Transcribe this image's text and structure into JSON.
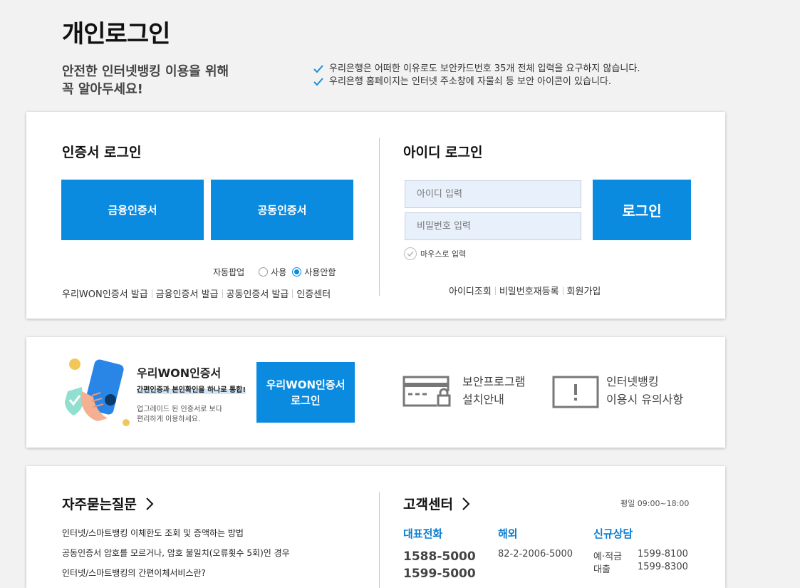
{
  "page": {
    "title": "개인로그인"
  },
  "notice": {
    "heading_line1": "안전한 인터넷뱅킹 이용을 위해",
    "heading_line2": "꼭 알아두세요!",
    "items": [
      "우리은행은 어떠한 이유로도 보안카드번호 35개 전체 입력을 요구하지 않습니다.",
      "우리은행 홈페이지는 인터넷 주소창에 자물쇠 등 보안 아이콘이 있습니다."
    ]
  },
  "cert_login": {
    "title": "인증서 로그인",
    "financial_cert_button": "금융인증서",
    "joint_cert_button": "공동인증서",
    "auto_popup_label": "자동팝업",
    "radio_use": "사용",
    "radio_no_use": "사용안함",
    "auto_popup_selected": "사용안함",
    "links": [
      "우리WON인증서 발급",
      "금융인증서 발급",
      "공동인증서 발급",
      "인증센터"
    ]
  },
  "id_login": {
    "title": "아이디 로그인",
    "id_placeholder": "아이디 입력",
    "password_placeholder": "비밀번호 입력",
    "login_button": "로그인",
    "mouse_input_label": "마우스로 입력",
    "links": [
      "아이디조회",
      "비밀번호재등록",
      "회원가입"
    ]
  },
  "won_cert": {
    "title": "우리WON인증서",
    "subtitle": "간편인증과 본인확인을 하나로 통합!",
    "desc_line1": "업그레이드 된 인증서로 보다",
    "desc_line2": "편리하게 이용하세요.",
    "login_button_line1": "우리WON인증서",
    "login_button_line2": "로그인",
    "security_program_line1": "보안프로그램",
    "security_program_line2": "설치안내",
    "caution_line1": "인터넷뱅킹",
    "caution_line2": "이용시 유의사항"
  },
  "faq": {
    "title": "자주묻는질문",
    "items": [
      "인터넷/스마트뱅킹 이체한도 조회 및 증액하는 방법",
      "공동인증서 암호를 모르거나, 암호 불일치(오류횟수 5회)인 경우",
      "인터넷/스마트뱅킹의 간편이체서비스란?"
    ]
  },
  "customer_center": {
    "title": "고객센터",
    "hours": "평일 09:00~18:00",
    "main_phone_label": "대표전화",
    "main_phone_1": "1588-5000",
    "main_phone_2": "1599-5000",
    "overseas_label": "해외",
    "overseas_phone": "82-2-2006-5000",
    "new_consult_label": "신규상담",
    "deposit_label": "예·적금",
    "deposit_phone": "1599-8100",
    "loan_label": "대출",
    "loan_phone": "1599-8300"
  },
  "colors": {
    "primary_blue": "#0a8be0",
    "input_bg": "#e8f0fb",
    "background": "#f2f2f2",
    "link_blue": "#0a7dd0"
  },
  "icons": [
    "check-icon",
    "phone-hand-icon",
    "card-lock-icon",
    "warning-box-icon",
    "chevron-right-icon",
    "mouse-check-icon"
  ]
}
